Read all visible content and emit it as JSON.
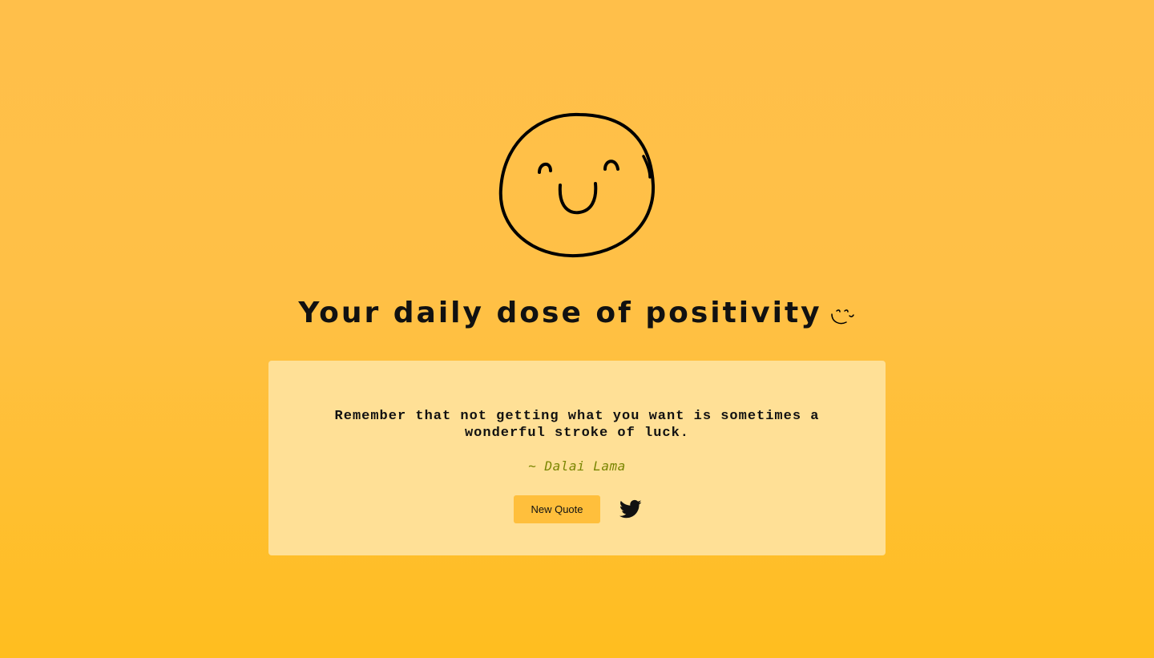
{
  "page": {
    "title": "Your daily dose of positivity"
  },
  "icons": {
    "hero": "smiley-face-icon",
    "title_emoji": "smiley-icon",
    "share": "twitter-icon"
  },
  "quote": {
    "text": "Remember that not getting what you want is sometimes a wonderful stroke of luck.",
    "author": "~ Dalai Lama"
  },
  "actions": {
    "new_quote_label": "New Quote"
  },
  "colors": {
    "background_top": "#ffbf4a",
    "background_bottom": "#ffbe1f",
    "card": "#ffe096",
    "button": "#ffbf3c",
    "author": "#7a8500"
  }
}
